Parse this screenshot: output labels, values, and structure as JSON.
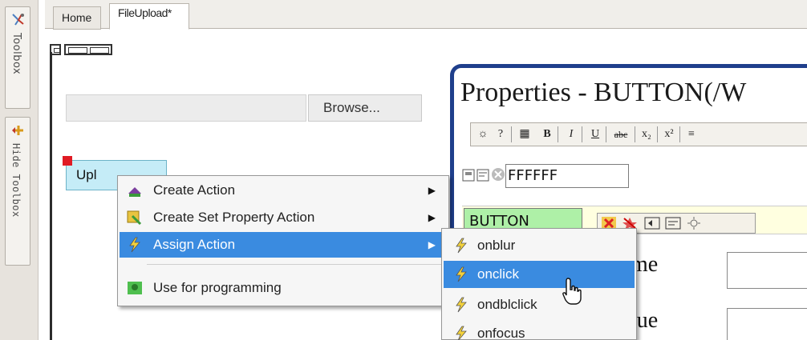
{
  "toolbox": {
    "toolbox_label": "Toolbox",
    "hide_toolbox_label": "Hide Toolbox"
  },
  "tabs": [
    {
      "label": "Home"
    },
    {
      "label": "FileUpload*"
    }
  ],
  "form": {
    "browse_label": "Browse...",
    "upload_label": "Upl"
  },
  "context_menu": {
    "items": [
      {
        "label": "Create Action",
        "has_submenu": true
      },
      {
        "label": "Create Set Property Action",
        "has_submenu": true
      },
      {
        "label": "Assign Action",
        "has_submenu": true,
        "highlighted": true
      },
      {
        "label": "Use for programming",
        "has_submenu": false
      }
    ]
  },
  "submenu": {
    "items": [
      {
        "label": "onblur"
      },
      {
        "label": "onclick",
        "highlighted": true
      },
      {
        "label": "ondblclick"
      },
      {
        "label": "onfocus"
      }
    ]
  },
  "properties": {
    "title": "Properties - BUTTON(/W",
    "color_value": "FFFFFF",
    "element_type": "BUTTON",
    "rows": [
      {
        "label": "me"
      },
      {
        "label": "lue"
      }
    ]
  },
  "colors": {
    "highlight": "#3a8be0",
    "panel_border": "#1f3f8c",
    "upload_button": "#c5ecf7",
    "type_badge": "#aef0a7"
  }
}
